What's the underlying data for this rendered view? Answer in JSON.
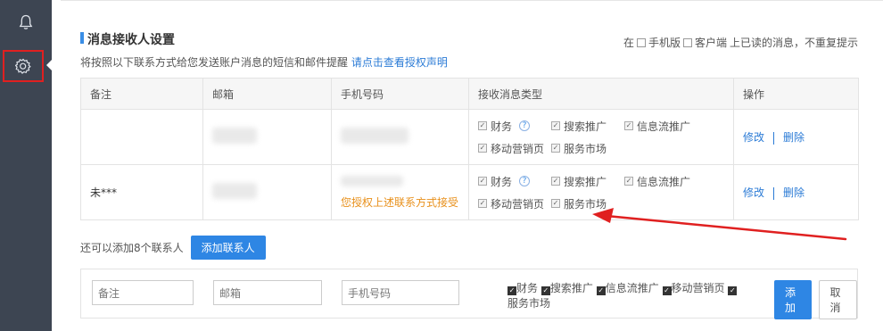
{
  "sidebar": {
    "items": [
      {
        "icon": "bell-icon"
      },
      {
        "icon": "gear-icon",
        "active": true
      }
    ]
  },
  "header": {
    "title": "消息接收人设置",
    "subtitle": "将按照以下联系方式给您发送账户消息的短信和邮件提醒",
    "subtitle_link": "请点击查看授权声明",
    "opts": {
      "prefix": "在",
      "mobile": "手机版",
      "client": "客户端",
      "suffix": "上已读的消息，不重复提示"
    }
  },
  "table": {
    "columns": [
      "备注",
      "邮箱",
      "手机号码",
      "接收消息类型",
      "操作"
    ],
    "msg_types": [
      "财务",
      "搜索推广",
      "信息流推广",
      "移动营销页",
      "服务市场"
    ],
    "rows": [
      {
        "remark": "",
        "phone_note": "",
        "edit": "修改",
        "delete": "删除"
      },
      {
        "remark": "未***",
        "phone_note": "您授权上述联系方式接受..",
        "edit": "修改",
        "delete": "删除"
      }
    ]
  },
  "add": {
    "text": "还可以添加8个联系人",
    "button": "添加联系人"
  },
  "form": {
    "remark_placeholder": "备注",
    "email_placeholder": "邮箱",
    "phone_placeholder": "手机号码",
    "types": [
      "财务",
      "搜索推广",
      "信息流推广",
      "移动营销页",
      "服务市场"
    ],
    "add_button": "添加",
    "cancel_button": "取消"
  },
  "colors": {
    "accent": "#2e86e4",
    "sidebar": "#3d4552",
    "warn": "#e8901b",
    "annotation": "#e02020"
  }
}
